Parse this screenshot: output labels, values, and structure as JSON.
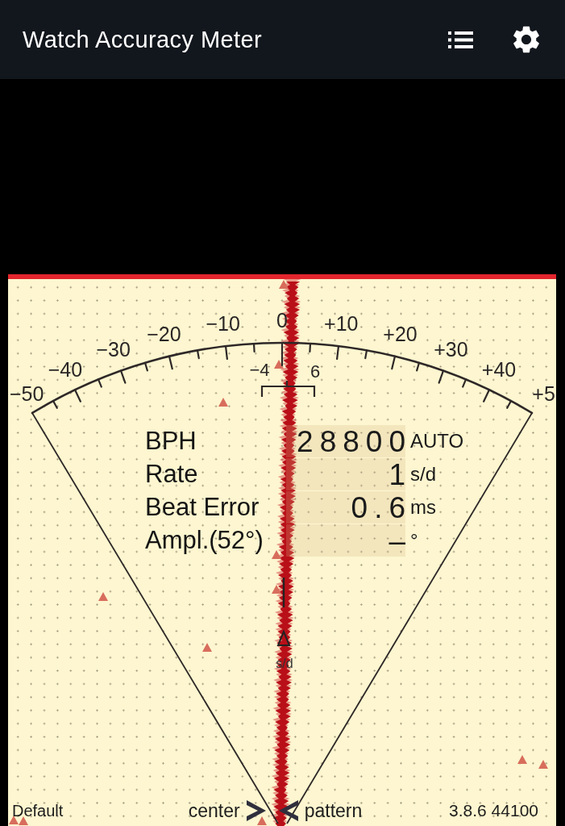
{
  "app_bar": {
    "title": "Watch Accuracy Meter"
  },
  "dial": {
    "scale_labels": [
      "−50",
      "−40",
      "−30",
      "−20",
      "−10",
      "0",
      "+10",
      "+20",
      "+30",
      "+40",
      "+5"
    ],
    "range": {
      "low": "−4",
      "high": "6"
    },
    "pointer_unit": "s/d"
  },
  "readouts": [
    {
      "label": "BPH",
      "value": "28800",
      "unit": "AUTO"
    },
    {
      "label": "Rate",
      "value": "1",
      "unit": "s/d"
    },
    {
      "label": "Beat Error",
      "value": "0.6",
      "unit": "ms"
    },
    {
      "label": "Ampl.(52°)",
      "value": "–",
      "unit": "°"
    }
  ],
  "footer": {
    "profile": "Default",
    "left_hint": "center",
    "right_hint": "pattern",
    "version": "3.8.6 44100"
  }
}
